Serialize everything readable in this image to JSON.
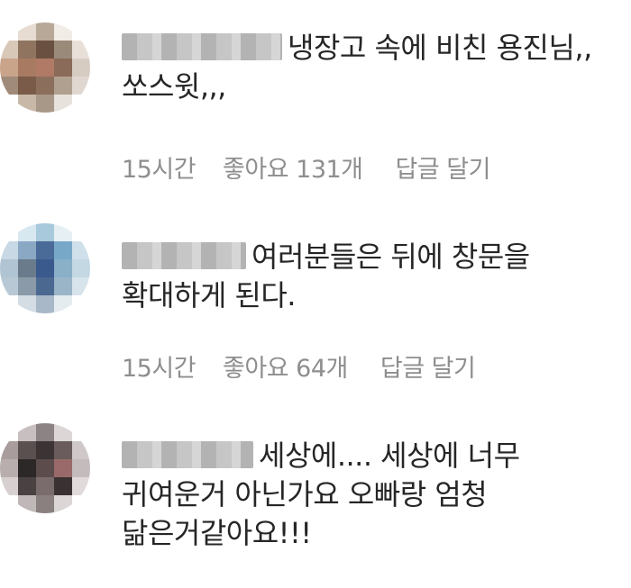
{
  "comments": [
    {
      "text": "냉장고 속에 비친 용진님,, 쏘스윗,,,",
      "time": "15시간",
      "likes": "좋아요 131개",
      "reply": "답글 달기",
      "avatar_colors": [
        "#ffffff",
        "#e6dcd2",
        "#b8a898",
        "#f2ece6",
        "#ffffff",
        "#d8c8b8",
        "#8f7460",
        "#6a5040",
        "#9a8a7a",
        "#e8e0d8",
        "#c9a48a",
        "#a87a62",
        "#b07a66",
        "#8a6a58",
        "#d6ccc2",
        "#a08a7a",
        "#7a5a48",
        "#8c6e5c",
        "#b0a090",
        "#e0d8d0",
        "#ffffff",
        "#c8b8a8",
        "#a89888",
        "#e8e2dc",
        "#ffffff"
      ]
    },
    {
      "text": "여러분들은 뒤에 창문을 확대하게 된다.",
      "time": "15시간",
      "likes": "좋아요 64개",
      "reply": "답글 달기",
      "avatar_colors": [
        "#ffffff",
        "#d8e8f0",
        "#a8c8dc",
        "#e6f0f4",
        "#ffffff",
        "#c8d8e4",
        "#8aa8c4",
        "#4a6a98",
        "#78a8c8",
        "#d0e0ea",
        "#b0c4d4",
        "#6a7c8c",
        "#3a5a8e",
        "#8ab0c8",
        "#c4d8e4",
        "#b8c8d4",
        "#8a9aa8",
        "#4a6890",
        "#9ab4c8",
        "#d8e4ec",
        "#ffffff",
        "#d4dce4",
        "#a8b8c8",
        "#e4ecf0",
        "#ffffff"
      ]
    },
    {
      "text": "세상에.... 세상에 너무 귀여운거 아닌가요 오빠랑 엄청 닮은거같아요!!!",
      "time": "",
      "likes": "",
      "reply": "",
      "avatar_colors": [
        "#ffffff",
        "#c8c0c0",
        "#8c8484",
        "#dcd6d6",
        "#ffffff",
        "#a89c9c",
        "#5a5050",
        "#3c3434",
        "#6a5c5c",
        "#d0c8c8",
        "#b8aeae",
        "#2c2828",
        "#5c4c4c",
        "#9a6a6a",
        "#c4bcbc",
        "#d8d0d0",
        "#4a4242",
        "#7a6c6c",
        "#3a3232",
        "#e0dada",
        "#ffffff",
        "#c0b8b8",
        "#8a8080",
        "#dcd6d6",
        "#ffffff"
      ]
    }
  ]
}
